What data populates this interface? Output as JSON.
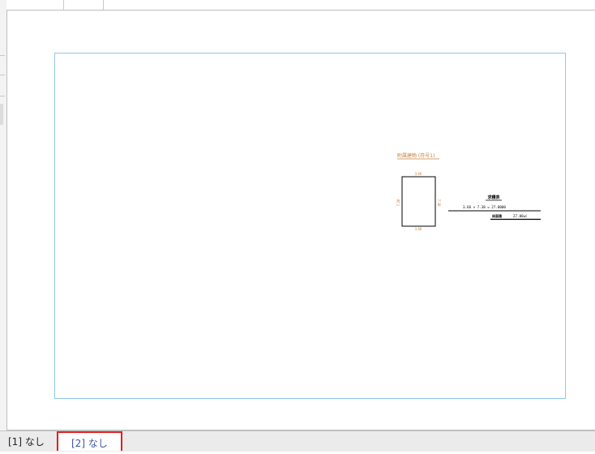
{
  "tabs": [
    {
      "label": "[1] なし",
      "active": false
    },
    {
      "label": "[2] なし",
      "active": true
    }
  ],
  "drawing": {
    "plan_label": "附属建物 (符号1)",
    "calc_heading": "求積表",
    "calc_row": "3.66 × 7.38 = 27.0000",
    "area_label": "床面積",
    "area_value": "27.00㎡",
    "dim_top": "3.66",
    "dim_bottom": "3.66",
    "dim_left": "7.38",
    "dim_right": "7.38"
  },
  "colors": {
    "sheet_border": "#8ec8e8",
    "dimension_text": "#c8823c",
    "active_tab_border": "#e01f1f",
    "active_tab_text": "#3a56b0"
  }
}
